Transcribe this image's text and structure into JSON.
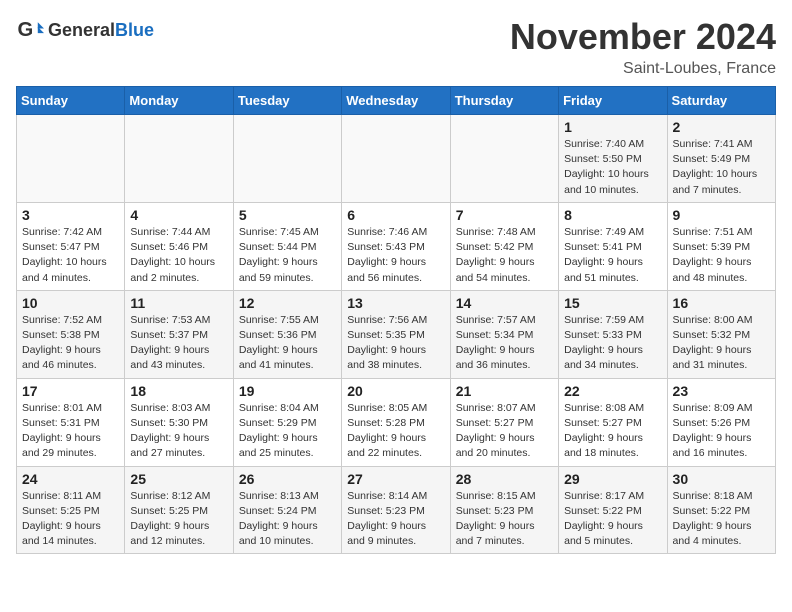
{
  "header": {
    "logo_general": "General",
    "logo_blue": "Blue",
    "title": "November 2024",
    "location": "Saint-Loubes, France"
  },
  "weekdays": [
    "Sunday",
    "Monday",
    "Tuesday",
    "Wednesday",
    "Thursday",
    "Friday",
    "Saturday"
  ],
  "weeks": [
    [
      {
        "day": "",
        "info": ""
      },
      {
        "day": "",
        "info": ""
      },
      {
        "day": "",
        "info": ""
      },
      {
        "day": "",
        "info": ""
      },
      {
        "day": "",
        "info": ""
      },
      {
        "day": "1",
        "info": "Sunrise: 7:40 AM\nSunset: 5:50 PM\nDaylight: 10 hours and 10 minutes."
      },
      {
        "day": "2",
        "info": "Sunrise: 7:41 AM\nSunset: 5:49 PM\nDaylight: 10 hours and 7 minutes."
      }
    ],
    [
      {
        "day": "3",
        "info": "Sunrise: 7:42 AM\nSunset: 5:47 PM\nDaylight: 10 hours and 4 minutes."
      },
      {
        "day": "4",
        "info": "Sunrise: 7:44 AM\nSunset: 5:46 PM\nDaylight: 10 hours and 2 minutes."
      },
      {
        "day": "5",
        "info": "Sunrise: 7:45 AM\nSunset: 5:44 PM\nDaylight: 9 hours and 59 minutes."
      },
      {
        "day": "6",
        "info": "Sunrise: 7:46 AM\nSunset: 5:43 PM\nDaylight: 9 hours and 56 minutes."
      },
      {
        "day": "7",
        "info": "Sunrise: 7:48 AM\nSunset: 5:42 PM\nDaylight: 9 hours and 54 minutes."
      },
      {
        "day": "8",
        "info": "Sunrise: 7:49 AM\nSunset: 5:41 PM\nDaylight: 9 hours and 51 minutes."
      },
      {
        "day": "9",
        "info": "Sunrise: 7:51 AM\nSunset: 5:39 PM\nDaylight: 9 hours and 48 minutes."
      }
    ],
    [
      {
        "day": "10",
        "info": "Sunrise: 7:52 AM\nSunset: 5:38 PM\nDaylight: 9 hours and 46 minutes."
      },
      {
        "day": "11",
        "info": "Sunrise: 7:53 AM\nSunset: 5:37 PM\nDaylight: 9 hours and 43 minutes."
      },
      {
        "day": "12",
        "info": "Sunrise: 7:55 AM\nSunset: 5:36 PM\nDaylight: 9 hours and 41 minutes."
      },
      {
        "day": "13",
        "info": "Sunrise: 7:56 AM\nSunset: 5:35 PM\nDaylight: 9 hours and 38 minutes."
      },
      {
        "day": "14",
        "info": "Sunrise: 7:57 AM\nSunset: 5:34 PM\nDaylight: 9 hours and 36 minutes."
      },
      {
        "day": "15",
        "info": "Sunrise: 7:59 AM\nSunset: 5:33 PM\nDaylight: 9 hours and 34 minutes."
      },
      {
        "day": "16",
        "info": "Sunrise: 8:00 AM\nSunset: 5:32 PM\nDaylight: 9 hours and 31 minutes."
      }
    ],
    [
      {
        "day": "17",
        "info": "Sunrise: 8:01 AM\nSunset: 5:31 PM\nDaylight: 9 hours and 29 minutes."
      },
      {
        "day": "18",
        "info": "Sunrise: 8:03 AM\nSunset: 5:30 PM\nDaylight: 9 hours and 27 minutes."
      },
      {
        "day": "19",
        "info": "Sunrise: 8:04 AM\nSunset: 5:29 PM\nDaylight: 9 hours and 25 minutes."
      },
      {
        "day": "20",
        "info": "Sunrise: 8:05 AM\nSunset: 5:28 PM\nDaylight: 9 hours and 22 minutes."
      },
      {
        "day": "21",
        "info": "Sunrise: 8:07 AM\nSunset: 5:27 PM\nDaylight: 9 hours and 20 minutes."
      },
      {
        "day": "22",
        "info": "Sunrise: 8:08 AM\nSunset: 5:27 PM\nDaylight: 9 hours and 18 minutes."
      },
      {
        "day": "23",
        "info": "Sunrise: 8:09 AM\nSunset: 5:26 PM\nDaylight: 9 hours and 16 minutes."
      }
    ],
    [
      {
        "day": "24",
        "info": "Sunrise: 8:11 AM\nSunset: 5:25 PM\nDaylight: 9 hours and 14 minutes."
      },
      {
        "day": "25",
        "info": "Sunrise: 8:12 AM\nSunset: 5:25 PM\nDaylight: 9 hours and 12 minutes."
      },
      {
        "day": "26",
        "info": "Sunrise: 8:13 AM\nSunset: 5:24 PM\nDaylight: 9 hours and 10 minutes."
      },
      {
        "day": "27",
        "info": "Sunrise: 8:14 AM\nSunset: 5:23 PM\nDaylight: 9 hours and 9 minutes."
      },
      {
        "day": "28",
        "info": "Sunrise: 8:15 AM\nSunset: 5:23 PM\nDaylight: 9 hours and 7 minutes."
      },
      {
        "day": "29",
        "info": "Sunrise: 8:17 AM\nSunset: 5:22 PM\nDaylight: 9 hours and 5 minutes."
      },
      {
        "day": "30",
        "info": "Sunrise: 8:18 AM\nSunset: 5:22 PM\nDaylight: 9 hours and 4 minutes."
      }
    ]
  ]
}
